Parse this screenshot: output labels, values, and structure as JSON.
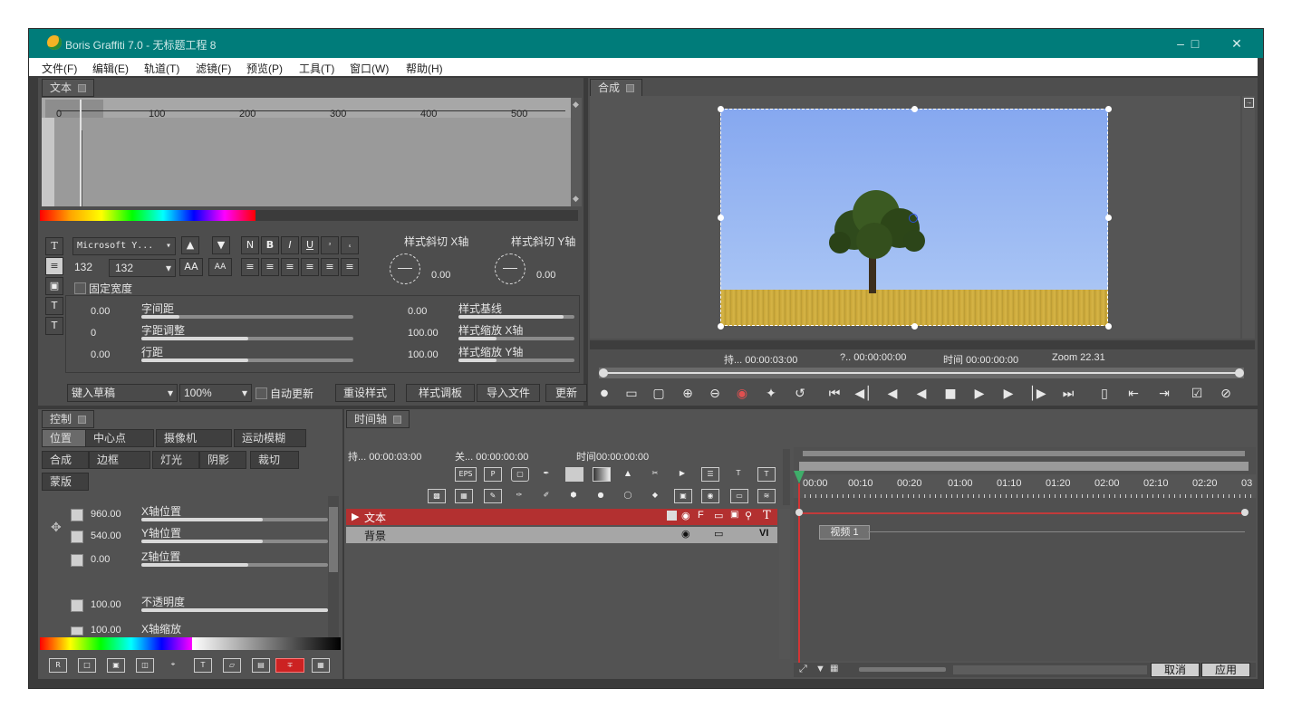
{
  "window": {
    "title": "Boris Graffiti 7.0 - 无标题工程 8"
  },
  "menu": [
    "文件(F)",
    "编辑(E)",
    "轨道(T)",
    "滤镜(F)",
    "预览(P)",
    "工具(T)",
    "窗口(W)",
    "帮助(H)"
  ],
  "text_panel": {
    "tab": "文本",
    "ruler": [
      "0",
      "100",
      "200",
      "300",
      "400",
      "500"
    ],
    "font": "Microsoft Y...",
    "size_left": "132",
    "size_combo": "132",
    "fixed_width": "固定宽度",
    "style_btns": [
      "N",
      "B",
      "I",
      "U"
    ],
    "skew_x_label": "样式斜切 X轴",
    "skew_y_label": "样式斜切 Y轴",
    "skew_x": "0.00",
    "skew_y": "0.00",
    "rows": [
      {
        "v": "0.00",
        "label": "字间距",
        "v2": "0.00",
        "label2": "样式基线"
      },
      {
        "v": "0",
        "label": "字距调整",
        "v2": "100.00",
        "label2": "样式缩放 X轴"
      },
      {
        "v": "0.00",
        "label": "行距",
        "v2": "100.00",
        "label2": "样式缩放 Y轴"
      }
    ],
    "bottom": {
      "key": "键入草稿",
      "zoom": "100%",
      "auto": "自动更新",
      "reset": "重设样式",
      "palette": "样式调板",
      "import": "导入文件",
      "update": "更新"
    }
  },
  "comp_panel": {
    "tab": "合成",
    "duration": "持... 00:00:03:00",
    "q": "?.. 00:00:00:00",
    "time": "时间 00:00:00:00",
    "zoom": "Zoom  22.31"
  },
  "control_panel": {
    "tab": "控制",
    "tabs1": [
      "位置",
      "中心点",
      "摄像机",
      "运动模糊"
    ],
    "tabs2": [
      "合成",
      "边框",
      "灯光",
      "阴影",
      "裁切"
    ],
    "tabs3": [
      "蒙版"
    ],
    "rows": [
      {
        "v": "960.00",
        "label": "X轴位置"
      },
      {
        "v": "540.00",
        "label": "Y轴位置"
      },
      {
        "v": "0.00",
        "label": "Z轴位置"
      },
      {
        "v": "100.00",
        "label": "不透明度"
      },
      {
        "v": "100.00",
        "label": "X轴缩放"
      }
    ]
  },
  "timeline": {
    "tab": "时间轴",
    "dur": "持... 00:00:03:00",
    "rel": "关... 00:00:00:00",
    "time": "时间00:00:00:00",
    "btn_eps": "EPS",
    "btn_p": "P",
    "track1": "文本",
    "track2": "背景",
    "track_t": "T",
    "track_vi": "VI",
    "clip": "视频 1",
    "scale": [
      "00:00",
      "00:10",
      "00:20",
      "01:00",
      "01:10",
      "01:20",
      "02:00",
      "02:10",
      "02:20",
      "03"
    ],
    "cancel": "取消",
    "apply": "应用"
  },
  "colors": {
    "titlebar": "#007c7a",
    "track_red": "#b33030"
  }
}
